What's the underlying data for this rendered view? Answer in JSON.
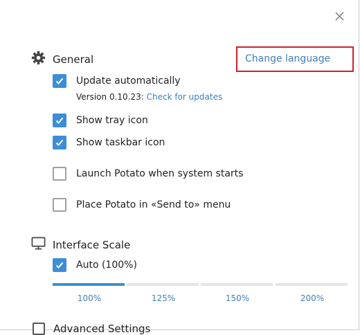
{
  "window": {
    "close_icon": "close-icon"
  },
  "general": {
    "title": "General",
    "icon": "gear-icon",
    "change_language": "Change language",
    "update_auto": {
      "label": "Update automatically",
      "checked": true
    },
    "version_prefix": "Version 0.10.23:",
    "check_updates": "Check for updates",
    "tray_icon": {
      "label": "Show tray icon",
      "checked": true
    },
    "taskbar_icon": {
      "label": "Show taskbar icon",
      "checked": true
    },
    "launch_start": {
      "label": "Launch Potato when system starts",
      "checked": false
    },
    "send_to": {
      "label": "Place Potato in «Send to» menu",
      "checked": false
    }
  },
  "interface_scale": {
    "title": "Interface Scale",
    "icon": "monitor-icon",
    "auto": {
      "label": "Auto (100%)",
      "checked": true
    },
    "options": [
      "100%",
      "125%",
      "150%",
      "200%"
    ],
    "selected_index": 0
  },
  "advanced": {
    "title": "Advanced Settings",
    "checked": false
  },
  "colors": {
    "accent": "#3d8ed6",
    "link": "#3f7fbf",
    "highlight_border": "#d21f2c"
  }
}
